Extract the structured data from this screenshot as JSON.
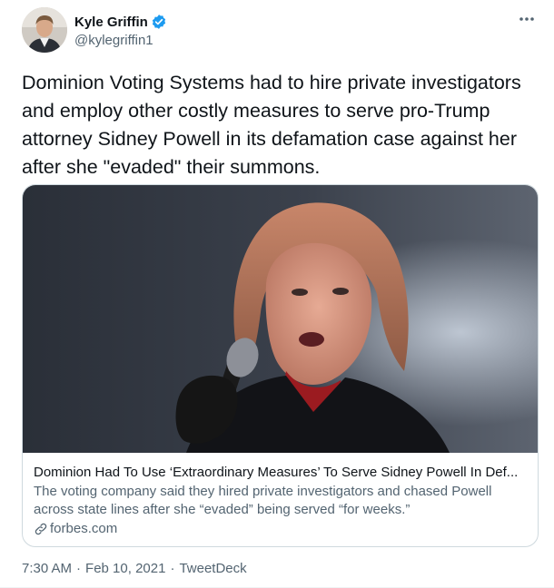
{
  "author": {
    "display_name": "Kyle Griffin",
    "handle": "@kylegriffin1",
    "verified": true,
    "verified_icon": "verified-badge-icon",
    "more_icon": "more-horizontal-icon"
  },
  "tweet": {
    "text": "Dominion Voting Systems had to hire private investigators and employ other costly measures to serve pro-Trump attorney Sidney Powell in its defamation case against her after she \"evaded\" their summons."
  },
  "card": {
    "title": "Dominion Had To Use ‘Extraordinary Measures’ To Serve Sidney Powell In Def...",
    "description": "The voting company said they hired private investigators and chased Powell across state lines after she “evaded” being served “for weeks.”",
    "domain": "forbes.com",
    "link_icon": "link-icon"
  },
  "meta": {
    "time": "7:30 AM",
    "separator": "·",
    "date": "Feb 10, 2021",
    "source": "TweetDeck"
  },
  "colors": {
    "text": "#0f1419",
    "secondary": "#536471",
    "border": "#cfd9de",
    "verified": "#1d9bf0"
  }
}
